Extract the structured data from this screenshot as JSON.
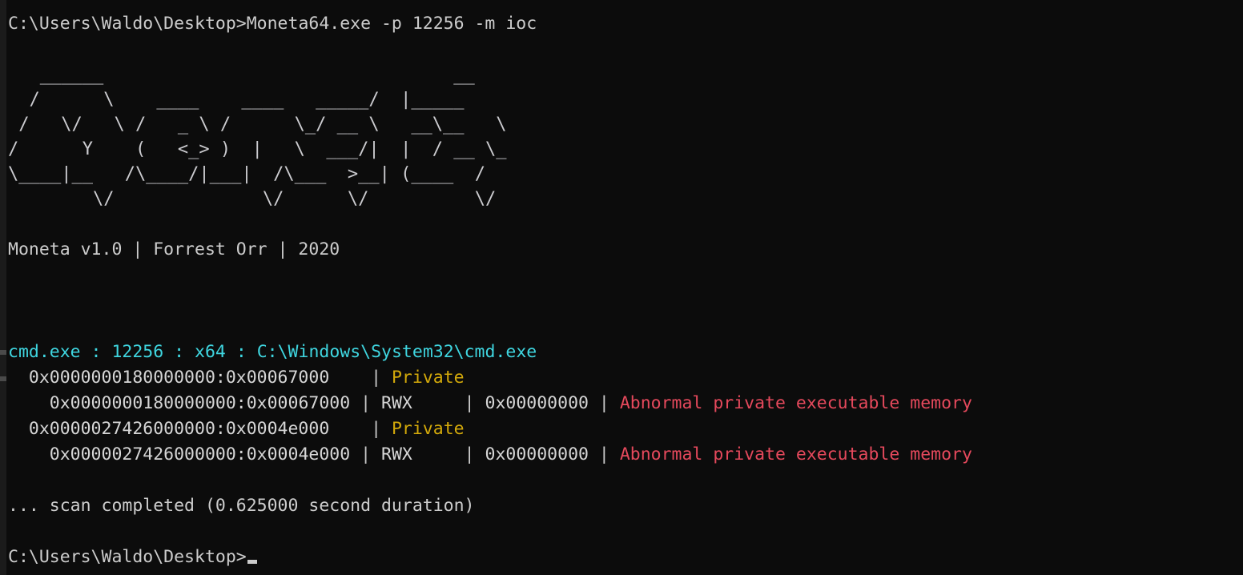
{
  "terminal": {
    "background": "#0c0c0c",
    "foreground": "#cccccc",
    "colors": {
      "cyan": "#3fd6e0",
      "yellow": "#d3a90a",
      "red": "#e5495c",
      "white": "#d6d6d6"
    }
  },
  "command_line": {
    "prompt": "C:\\Users\\Waldo\\Desktop>",
    "command": "Moneta64.exe -p 12256 -m ioc"
  },
  "banner": {
    "art_lines": [
      "   ______                                 __              ",
      "  /      \\    ____    ____   _____/  |_____   ",
      " /   \\/   \\ /   _ \\ /      \\_/ __ \\   __\\__   \\  ",
      "/      Y    (   <_> )  |   \\  ___/|  |  / __ \\_",
      "\\____|__   /\\____/|___|  /\\___  >__| (____  /",
      "        \\/              \\/      \\/          \\/ "
    ],
    "version_line": "Moneta v1.0 | Forrest Orr | 2020"
  },
  "scan": {
    "process": {
      "name": "cmd.exe",
      "pid": "12256",
      "arch": "x64",
      "path": "C:\\Windows\\System32\\cmd.exe",
      "separator": " : "
    },
    "regions": [
      {
        "address": "0x0000000180000000:0x00067000",
        "type": "Private",
        "subregions": [
          {
            "address": "0x0000000180000000:0x00067000",
            "protection": "RWX",
            "offset": "0x00000000",
            "finding": "Abnormal private executable memory"
          }
        ]
      },
      {
        "address": "0x0000027426000000:0x0004e000",
        "type": "Private",
        "subregions": [
          {
            "address": "0x0000027426000000:0x0004e000",
            "protection": "RWX",
            "offset": "0x00000000",
            "finding": "Abnormal private executable memory"
          }
        ]
      }
    ],
    "completion": "... scan completed (0.625000 second duration)"
  },
  "final_prompt": {
    "prompt": "C:\\Users\\Waldo\\Desktop>"
  },
  "separators": {
    "pipe": "|"
  }
}
